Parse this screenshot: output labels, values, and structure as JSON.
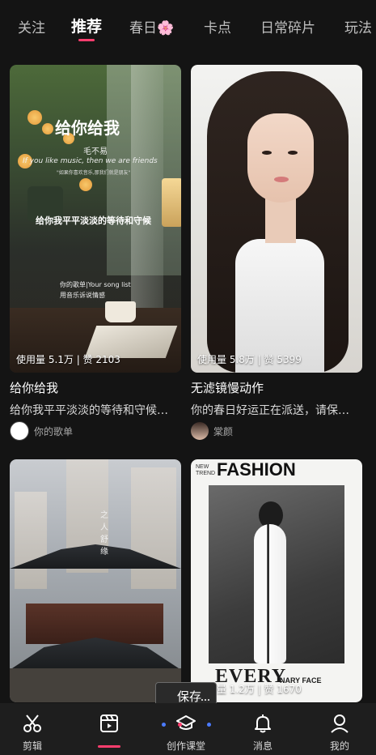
{
  "tabs": [
    {
      "label": "关注",
      "active": false
    },
    {
      "label": "推荐",
      "active": true
    },
    {
      "label": "春日🌸",
      "active": false
    },
    {
      "label": "卡点",
      "active": false
    },
    {
      "label": "日常碎片",
      "active": false
    },
    {
      "label": "玩法",
      "active": false
    }
  ],
  "cards": [
    {
      "usage": "使用量 5.1万",
      "likes": "赞 2103",
      "title": "给你给我",
      "description": "给你我平平淡淡的等待和守候…",
      "author": "你的歌单",
      "art": {
        "title": "给你给我",
        "artist": "毛不易",
        "english": "If you like music, then we are friends",
        "small": "\"如果你喜欢音乐,那我们就是朋友\"",
        "line": "给你我平平淡淡的等待和守候",
        "list_line1": "你的歌单|Your song list",
        "list_line2": "用音乐诉说情感"
      }
    },
    {
      "usage": "使用量 5.8万",
      "likes": "赞 5399",
      "title": "无滤镜慢动作",
      "description": "你的春日好运正在派送，请保…",
      "author": "棠颜"
    },
    {
      "usage": "",
      "likes": "",
      "title": "",
      "description": "",
      "author": "",
      "art": {
        "vertical_text": "之人舒缘"
      }
    },
    {
      "usage": "使用量 1.2万",
      "likes": "赞 1670",
      "title": "",
      "description": "",
      "author": "",
      "art": {
        "new": "NEW",
        "trend": "TREND",
        "fashion": "FASHION",
        "every": "EVERY",
        "ordinary": "NARY FACE"
      }
    }
  ],
  "toast": {
    "label": "保存"
  },
  "nav": [
    {
      "label": "剪辑",
      "icon": "scissors-icon"
    },
    {
      "label": "",
      "icon": "clapper-icon",
      "active": true
    },
    {
      "label": "创作课堂",
      "icon": "graduation-cap-icon"
    },
    {
      "label": "消息",
      "icon": "bell-icon"
    },
    {
      "label": "我的",
      "icon": "person-icon"
    }
  ],
  "colors": {
    "accent": "#ff3e6e",
    "background": "#141414",
    "nav_background": "#1e1e1e"
  }
}
